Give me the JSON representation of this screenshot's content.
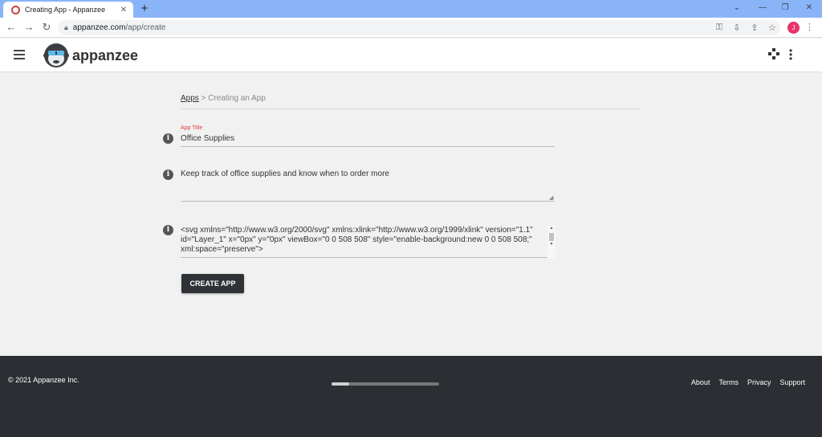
{
  "browser": {
    "tab_title": "Creating App - Appanzee",
    "tab_close": "✕",
    "new_tab": "+",
    "url_domain": "appanzee.com",
    "url_path": "/app/create",
    "profile_initial": "J"
  },
  "app": {
    "brand": "appanzee",
    "brand_color": "#333333"
  },
  "breadcrumb": {
    "root": "Apps",
    "separator": " > ",
    "current": "Creating an App"
  },
  "form": {
    "title_label": "App Title",
    "title_value": "Office Supplies",
    "description_value": "Keep track of office supplies and know when to order more",
    "icon_svg_value": "<svg xmlns=\"http://www.w3.org/2000/svg\" xmlns:xlink=\"http://www.w3.org/1999/xlink\" version=\"1.1\" id=\"Layer_1\" x=\"0px\" y=\"0px\" viewBox=\"0 0 508 508\" style=\"enable-background:new 0 0 508 508;\" xml:space=\"preserve\">",
    "submit_label": "CREATE APP",
    "label_color": "#e53935",
    "button_color": "#2f3337"
  },
  "footer": {
    "copyright": "© 2021 Appanzee Inc.",
    "links": [
      "About",
      "Terms",
      "Privacy",
      "Support"
    ],
    "background": "#2b2e32"
  }
}
